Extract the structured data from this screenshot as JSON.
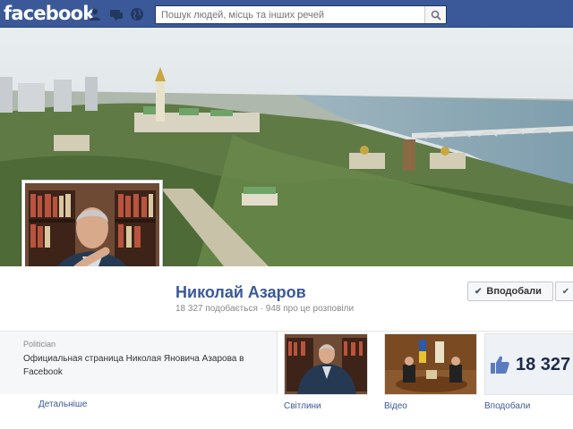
{
  "topbar": {
    "logo": "facebook",
    "search_placeholder": "Пошук людей, місць та інших речей",
    "icons": [
      "friend-requests-icon",
      "messages-icon",
      "notifications-globe-icon",
      "search-icon"
    ],
    "brand_color": "#3b5998"
  },
  "page": {
    "name": "Николай Азаров",
    "stats": "18 327 подобається · 948 про це розповіли",
    "like_button": "Вподобали"
  },
  "about": {
    "category": "Politician",
    "description": "Официальная страница Николая Яновича Азарова в Facebook",
    "more_link": "Детальніше"
  },
  "tiles": {
    "photos_label": "Світлини",
    "video_label": "Відео",
    "likes_label": "Вподобали",
    "likes_count": "18 327"
  }
}
